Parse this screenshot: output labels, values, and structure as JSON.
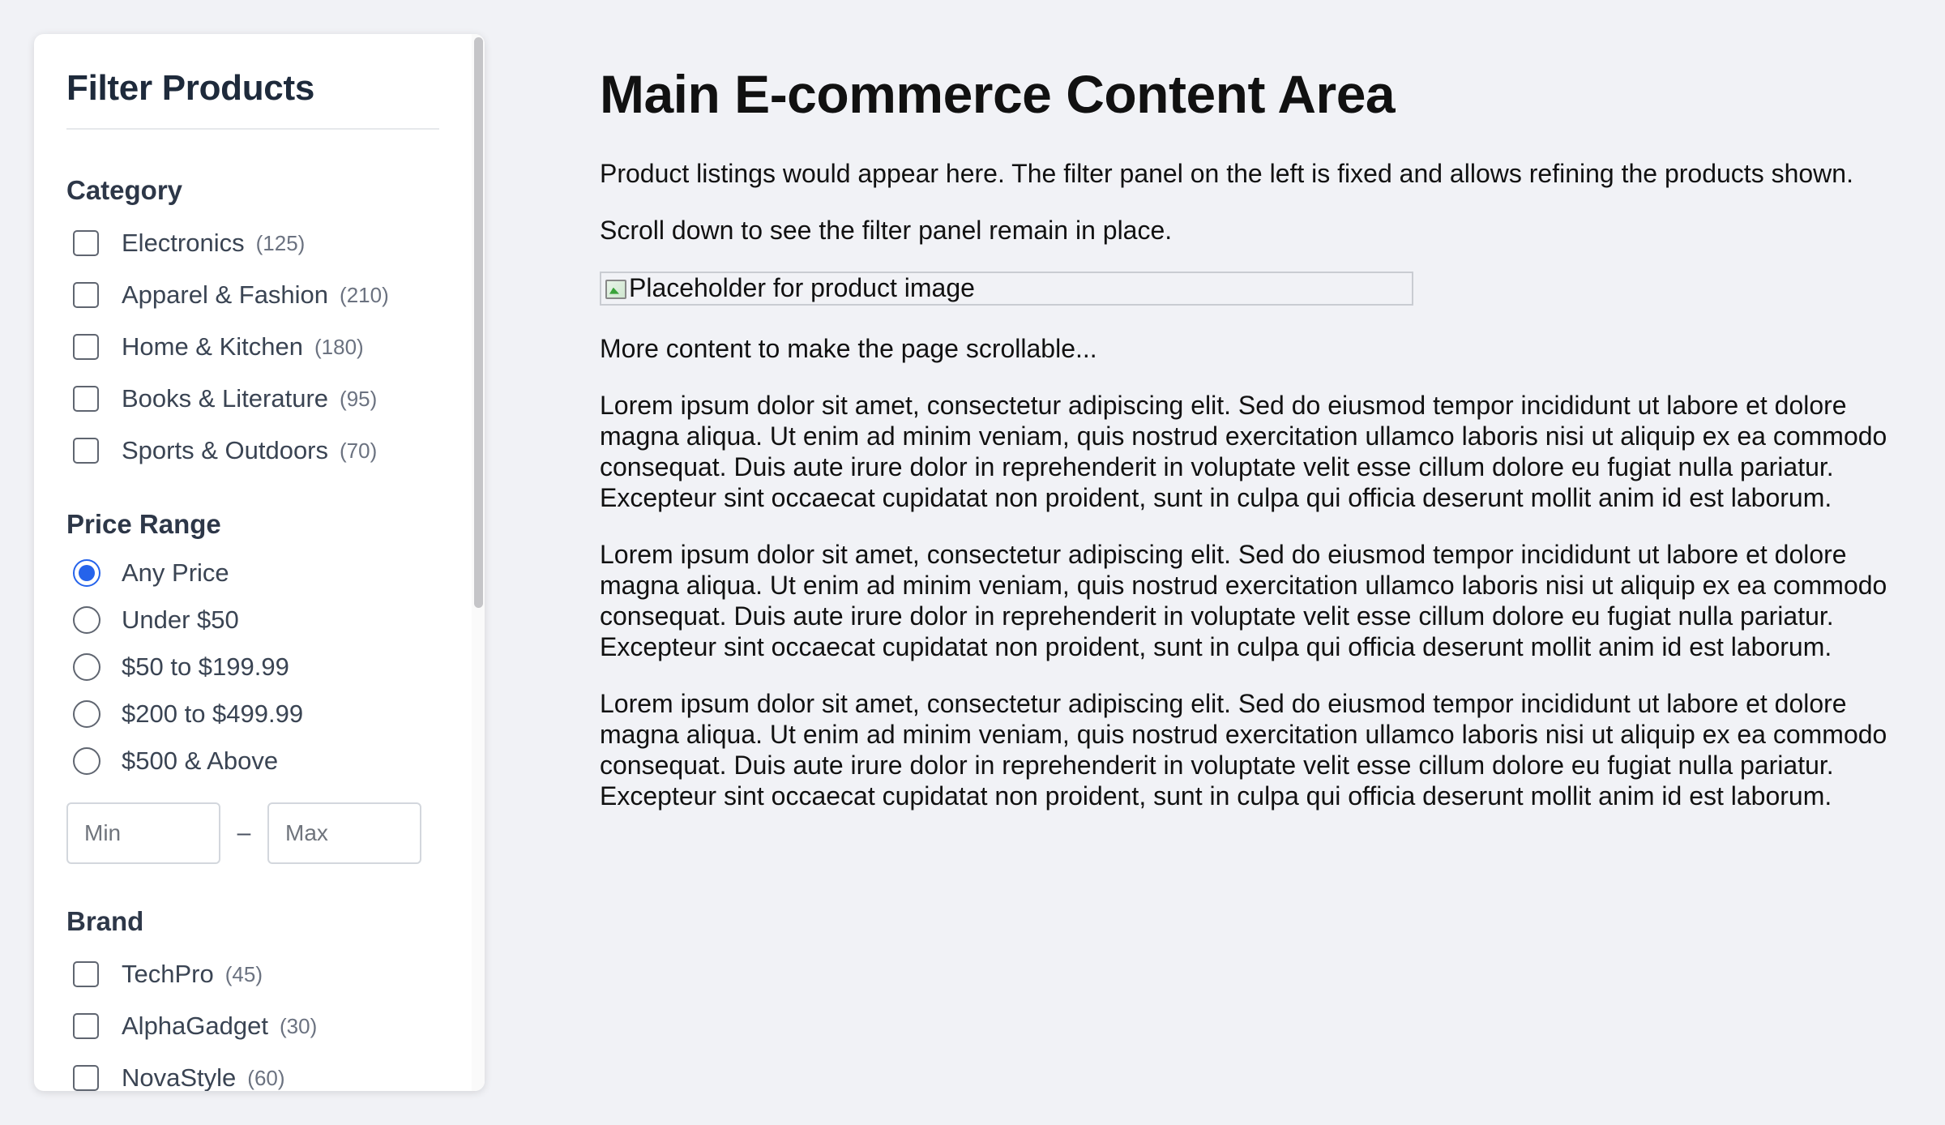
{
  "sidebar": {
    "title": "Filter Products",
    "category": {
      "title": "Category",
      "items": [
        {
          "label": "Electronics",
          "count": "(125)"
        },
        {
          "label": "Apparel & Fashion",
          "count": "(210)"
        },
        {
          "label": "Home & Kitchen",
          "count": "(180)"
        },
        {
          "label": "Books & Literature",
          "count": "(95)"
        },
        {
          "label": "Sports & Outdoors",
          "count": "(70)"
        }
      ]
    },
    "price": {
      "title": "Price Range",
      "options": [
        {
          "label": "Any Price",
          "checked": true
        },
        {
          "label": "Under $50",
          "checked": false
        },
        {
          "label": "$50 to $199.99",
          "checked": false
        },
        {
          "label": "$200 to $499.99",
          "checked": false
        },
        {
          "label": "$500 & Above",
          "checked": false
        }
      ],
      "min_placeholder": "Min",
      "max_placeholder": "Max",
      "separator": "–"
    },
    "brand": {
      "title": "Brand",
      "items": [
        {
          "label": "TechPro",
          "count": "(45)"
        },
        {
          "label": "AlphaGadget",
          "count": "(30)"
        },
        {
          "label": "NovaStyle",
          "count": "(60)"
        }
      ]
    }
  },
  "main": {
    "title": "Main E-commerce Content Area",
    "intro": "Product listings would appear here. The filter panel on the left is fixed and allows refining the products shown.",
    "scroll_note": "Scroll down to see the filter panel remain in place.",
    "image_alt": "Placeholder for product image",
    "more_content": "More content to make the page scrollable...",
    "lorem": [
      "Lorem ipsum dolor sit amet, consectetur adipiscing elit. Sed do eiusmod tempor incididunt ut labore et dolore magna aliqua. Ut enim ad minim veniam, quis nostrud exercitation ullamco laboris nisi ut aliquip ex ea commodo consequat. Duis aute irure dolor in reprehenderit in voluptate velit esse cillum dolore eu fugiat nulla pariatur. Excepteur sint occaecat cupidatat non proident, sunt in culpa qui officia deserunt mollit anim id est laborum.",
      "Lorem ipsum dolor sit amet, consectetur adipiscing elit. Sed do eiusmod tempor incididunt ut labore et dolore magna aliqua. Ut enim ad minim veniam, quis nostrud exercitation ullamco laboris nisi ut aliquip ex ea commodo consequat. Duis aute irure dolor in reprehenderit in voluptate velit esse cillum dolore eu fugiat nulla pariatur. Excepteur sint occaecat cupidatat non proident, sunt in culpa qui officia deserunt mollit anim id est laborum.",
      "Lorem ipsum dolor sit amet, consectetur adipiscing elit. Sed do eiusmod tempor incididunt ut labore et dolore magna aliqua. Ut enim ad minim veniam, quis nostrud exercitation ullamco laboris nisi ut aliquip ex ea commodo consequat. Duis aute irure dolor in reprehenderit in voluptate velit esse cillum dolore eu fugiat nulla pariatur. Excepteur sint occaecat cupidatat non proident, sunt in culpa qui officia deserunt mollit anim id est laborum."
    ]
  },
  "colors": {
    "accent": "#2563eb",
    "background": "#f1f2f6",
    "panel": "#ffffff",
    "heading": "#1e2a3b"
  }
}
